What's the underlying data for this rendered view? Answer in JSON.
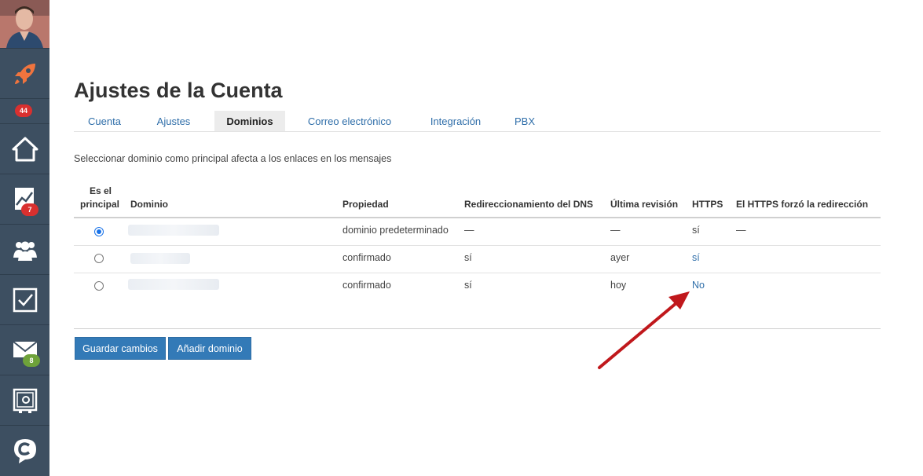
{
  "sidebar": {
    "items": [
      {
        "icon": "rocket-icon",
        "badge": null
      },
      {
        "icon": "home-icon",
        "badge": "44"
      },
      {
        "icon": "chart-icon",
        "badge": "7"
      },
      {
        "icon": "users-icon",
        "badge": null
      },
      {
        "icon": "tasks-icon",
        "badge": null
      },
      {
        "icon": "mail-icon",
        "badge": "8"
      },
      {
        "icon": "safe-icon",
        "badge": null
      },
      {
        "icon": "chat-icon",
        "badge": null
      }
    ],
    "colors": {
      "bg": "#3d4f61",
      "rocket": "#f0743e",
      "badge_red": "#d9302f",
      "badge_green": "#6ea23a"
    }
  },
  "page": {
    "title": "Ajustes de la Cuenta",
    "tabs": [
      {
        "label": "Cuenta"
      },
      {
        "label": "Ajustes"
      },
      {
        "label": "Dominios",
        "active": true
      },
      {
        "label": "Correo electrónico"
      },
      {
        "label": "Integración"
      },
      {
        "label": "PBX"
      }
    ],
    "intro": "Seleccionar dominio como principal afecta a los enlaces en los mensajes"
  },
  "table": {
    "headers": {
      "principal_line1": "Es el",
      "principal_line2": "principal",
      "domain": "Dominio",
      "property": "Propiedad",
      "dns": "Redireccionamiento del DNS",
      "last_check": "Última revisión",
      "https": "HTTPS",
      "https_redirect": "El HTTPS forzó la redirección"
    },
    "rows": [
      {
        "principal": true,
        "property": "dominio predeterminado",
        "dns": "—",
        "last_check": "—",
        "https": "sí",
        "https_redirect": "—"
      },
      {
        "principal": false,
        "property": "confirmado",
        "dns": "sí",
        "last_check": "ayer",
        "https": "sí",
        "https_redirect": ""
      },
      {
        "principal": false,
        "property": "confirmado",
        "dns": "sí",
        "last_check": "hoy",
        "https": "No",
        "https_redirect": ""
      }
    ]
  },
  "actions": {
    "save": "Guardar cambios",
    "add_domain": "Añadir dominio"
  },
  "annotation": {
    "arrow_color": "#c0181c"
  }
}
